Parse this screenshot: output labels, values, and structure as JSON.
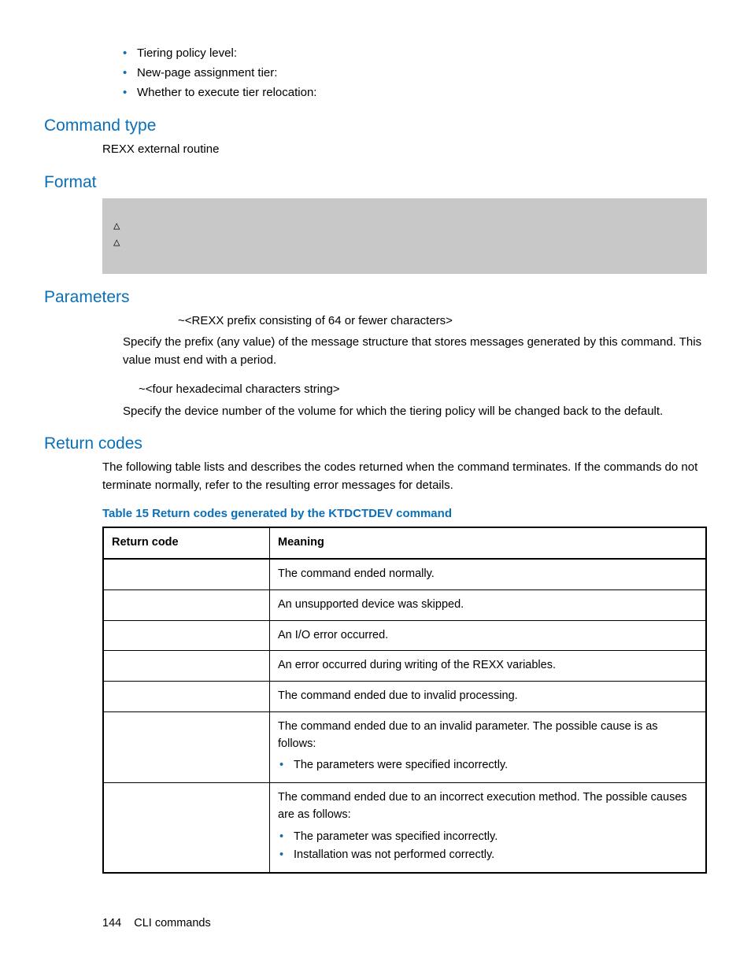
{
  "intro_bullets": [
    "Tiering policy level:",
    "New-page assignment tier:",
    "Whether to execute tier relocation:"
  ],
  "sections": {
    "command_type": {
      "heading": "Command type",
      "text": "REXX external routine"
    },
    "format": {
      "heading": "Format",
      "lines": [
        "△",
        "△"
      ]
    },
    "parameters": {
      "heading": "Parameters",
      "p1_sig": "~<REXX prefix consisting of 64 or fewer characters>",
      "p1_desc": "Specify the prefix (any value) of the message structure that stores messages generated by this command. This value must end with a period.",
      "p2_sig": "~<four hexadecimal characters string>",
      "p2_desc": "Specify the device number of the volume for which the tiering policy will be changed back to the default."
    },
    "return_codes": {
      "heading": "Return codes",
      "intro_a": "The following table lists and describes the codes returned when the ",
      "intro_b": " command terminates. If the commands do not terminate normally, refer to the resulting error messages for details.",
      "caption": "Table 15 Return codes generated by the KTDCTDEV command",
      "headers": {
        "col1": "Return code",
        "col2": "Meaning"
      },
      "rows": [
        {
          "code": "",
          "meaning": "The command ended normally."
        },
        {
          "code": "",
          "meaning": "An unsupported device was skipped."
        },
        {
          "code": "",
          "meaning": "An I/O error occurred."
        },
        {
          "code": "",
          "meaning": "An error occurred during writing of the REXX variables."
        },
        {
          "code": "",
          "meaning": "The command ended due to invalid processing."
        }
      ],
      "row6": {
        "intro": "The command ended due to an invalid parameter. The possible cause is as follows:",
        "bullets": [
          "The parameters were specified incorrectly."
        ]
      },
      "row7": {
        "intro": "The command ended due to an incorrect execution method. The possible causes are as follows:",
        "b1_a": "The ",
        "b1_b": " parameter was specified incorrectly.",
        "b2": "Installation was not performed correctly."
      }
    }
  },
  "footer": {
    "page_num": "144",
    "title": "CLI commands"
  }
}
